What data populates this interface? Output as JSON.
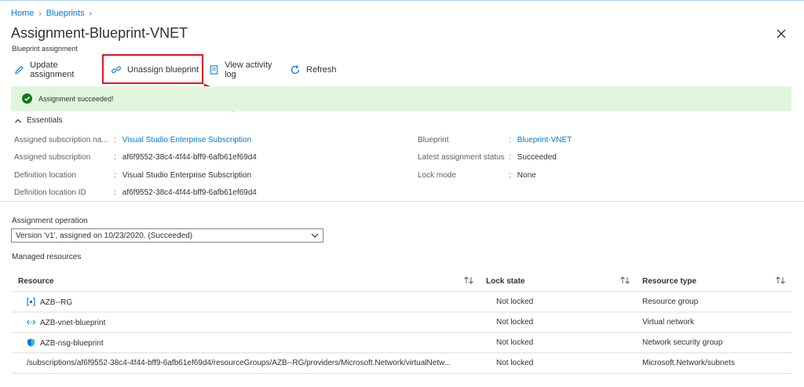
{
  "breadcrumb": {
    "items": [
      "Home",
      "Blueprints"
    ]
  },
  "page": {
    "title": "Assignment-Blueprint-VNET",
    "subtitle": "Blueprint assignment"
  },
  "toolbar": {
    "update_label": "Update assignment",
    "unassign_label": "Unassign blueprint",
    "activity_label": "View activity log",
    "refresh_label": "Refresh"
  },
  "alert": {
    "text": "Assignment succeeded!",
    "color": "#107c10"
  },
  "essentials": {
    "toggle_label": "Essentials",
    "left": [
      {
        "label": "Assigned subscription na...",
        "value": "Visual Studio Enterprise Subscription",
        "link": true
      },
      {
        "label": "Assigned subscription",
        "value": "af6f9552-38c4-4f44-bff9-6afb61ef69d4",
        "link": false
      },
      {
        "label": "Definition location",
        "value": "Visual Studio Enterprise Subscription",
        "link": false
      },
      {
        "label": "Definition location ID",
        "value": "af6f9552-38c4-4f44-bff9-6afb61ef69d4",
        "link": false
      }
    ],
    "right": [
      {
        "label": "Blueprint",
        "value": "Blueprint-VNET",
        "link": true
      },
      {
        "label": "Latest assignment status",
        "value": "Succeeded",
        "link": false
      },
      {
        "label": "Lock mode",
        "value": "None",
        "link": false
      }
    ]
  },
  "operation": {
    "label": "Assignment operation",
    "selected": "Version 'v1', assigned on 10/23/2020. (Succeeded)"
  },
  "managed": {
    "label": "Managed resources",
    "columns": [
      "Resource",
      "Lock state",
      "Resource type"
    ],
    "rows": [
      {
        "icon": "resource-group-icon",
        "resource": "AZB--RG",
        "lock": "Not locked",
        "type": "Resource group"
      },
      {
        "icon": "virtual-network-icon",
        "resource": "AZB-vnet-blueprint",
        "lock": "Not locked",
        "type": "Virtual network"
      },
      {
        "icon": "nsg-shield-icon",
        "resource": "AZB-nsg-blueprint",
        "lock": "Not locked",
        "type": "Network security group"
      },
      {
        "icon": "",
        "resource": "/subscriptions/af6f9552-38c4-4f44-bff9-6afb61ef69d4/resourceGroups/AZB--RG/providers/Microsoft.Network/virtualNetw...",
        "lock": "Not locked",
        "type": "Microsoft.Network/subnets"
      }
    ]
  },
  "colors": {
    "accent": "#0078d4",
    "highlight": "#e81123",
    "success_bg": "#dff6dd"
  }
}
